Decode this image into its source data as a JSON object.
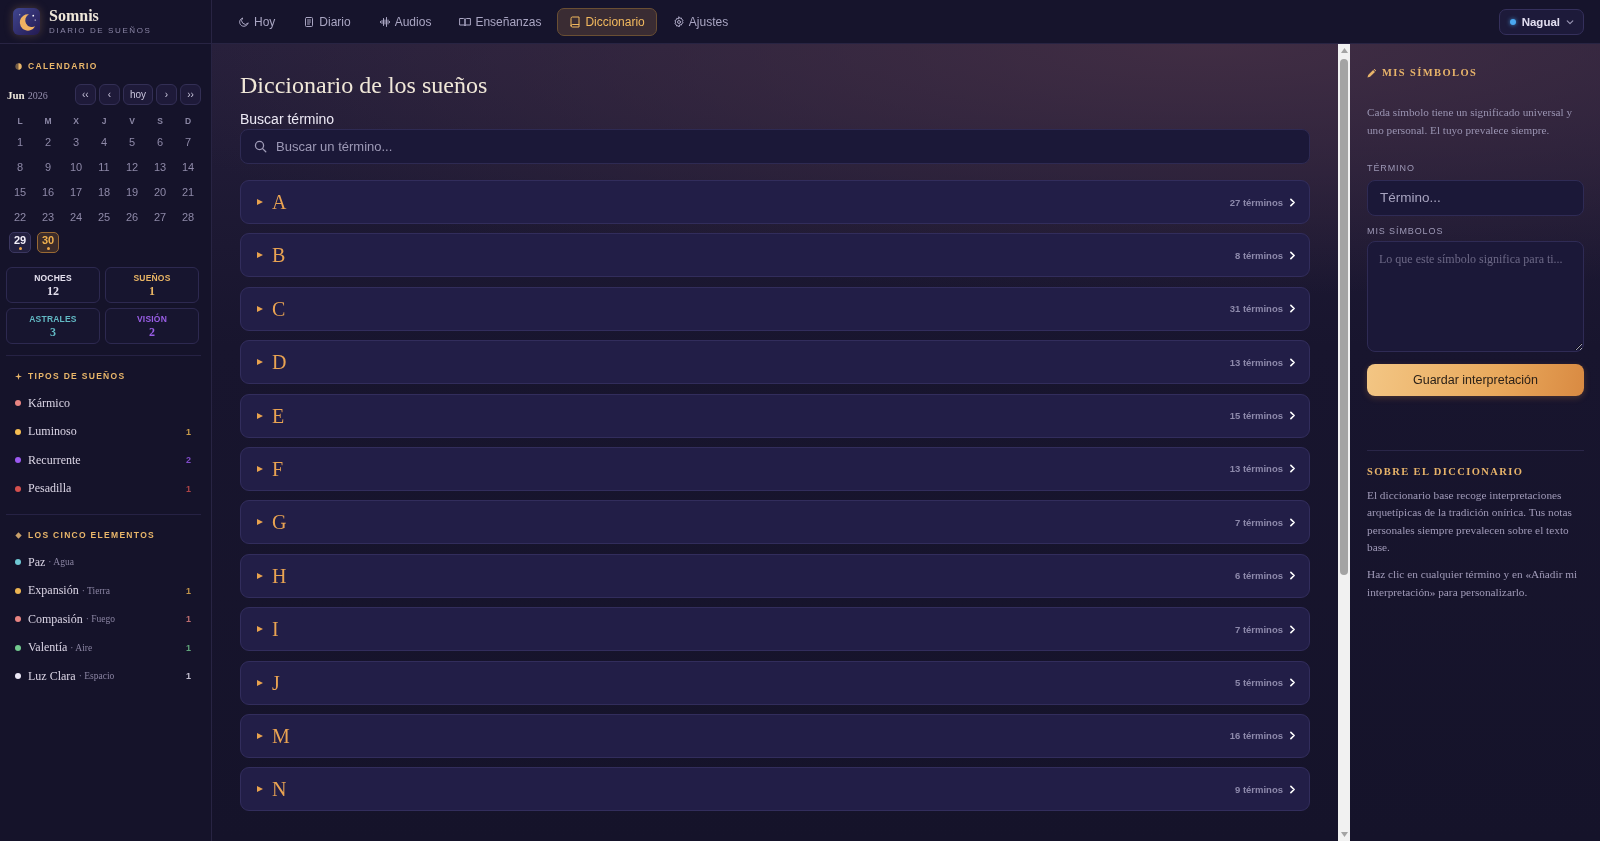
{
  "app": {
    "name": "Somnis",
    "tagline": "DIARIO DE SUEÑOS"
  },
  "nav": {
    "tabs": [
      {
        "label": "Hoy",
        "selected": false
      },
      {
        "label": "Diario",
        "selected": false
      },
      {
        "label": "Audios",
        "selected": false
      },
      {
        "label": "Enseñanzas",
        "selected": false
      },
      {
        "label": "Diccionario",
        "selected": true
      },
      {
        "label": "Ajustes",
        "selected": false
      }
    ],
    "profile": "Nagual"
  },
  "calendar": {
    "title": "CALENDARIO",
    "month": "Jun",
    "year": "2026",
    "buttons": [
      "‹‹",
      "‹",
      "hoy",
      "›",
      "››"
    ],
    "weekdays": [
      "L",
      "M",
      "X",
      "J",
      "V",
      "S",
      "D"
    ],
    "days": [
      {
        "day": "1",
        "has_entry": false,
        "selected": false
      },
      {
        "day": "2",
        "has_entry": false,
        "selected": false
      },
      {
        "day": "3",
        "has_entry": false,
        "selected": false
      },
      {
        "day": "4",
        "has_entry": false,
        "selected": false
      },
      {
        "day": "5",
        "has_entry": false,
        "selected": false
      },
      {
        "day": "6",
        "has_entry": false,
        "selected": false
      },
      {
        "day": "7",
        "has_entry": false,
        "selected": false
      },
      {
        "day": "8",
        "has_entry": false,
        "selected": false
      },
      {
        "day": "9",
        "has_entry": false,
        "selected": false
      },
      {
        "day": "10",
        "has_entry": false,
        "selected": false
      },
      {
        "day": "11",
        "has_entry": false,
        "selected": false
      },
      {
        "day": "12",
        "has_entry": false,
        "selected": false
      },
      {
        "day": "13",
        "has_entry": false,
        "selected": false
      },
      {
        "day": "14",
        "has_entry": false,
        "selected": false
      },
      {
        "day": "15",
        "has_entry": false,
        "selected": false
      },
      {
        "day": "16",
        "has_entry": false,
        "selected": false
      },
      {
        "day": "17",
        "has_entry": false,
        "selected": false
      },
      {
        "day": "18",
        "has_entry": false,
        "selected": false
      },
      {
        "day": "19",
        "has_entry": false,
        "selected": false
      },
      {
        "day": "20",
        "has_entry": false,
        "selected": false
      },
      {
        "day": "21",
        "has_entry": false,
        "selected": false
      },
      {
        "day": "22",
        "has_entry": false,
        "selected": false
      },
      {
        "day": "23",
        "has_entry": false,
        "selected": false
      },
      {
        "day": "24",
        "has_entry": false,
        "selected": false
      },
      {
        "day": "25",
        "has_entry": false,
        "selected": false
      },
      {
        "day": "26",
        "has_entry": false,
        "selected": false
      },
      {
        "day": "27",
        "has_entry": false,
        "selected": false
      },
      {
        "day": "28",
        "has_entry": false,
        "selected": false
      },
      {
        "day": "29",
        "has_entry": true,
        "selected": false
      },
      {
        "day": "30",
        "has_entry": true,
        "selected": true
      }
    ]
  },
  "stats": [
    {
      "label": "NOCHES",
      "value": "12",
      "color": "#e4e0ee"
    },
    {
      "label": "SUEÑOS",
      "value": "1",
      "color": "#e8b464"
    },
    {
      "label": "ASTRALES",
      "value": "3",
      "color": "#62b9c4"
    },
    {
      "label": "VISIÓN",
      "value": "2",
      "color": "#9a5ee6"
    }
  ],
  "dream_types": {
    "title": "TIPOS DE SUEÑOS",
    "items": [
      {
        "name": "Kármico",
        "color": "#e88482"
      },
      {
        "name": "Luminoso",
        "color": "#f5bd52",
        "count": "1"
      },
      {
        "name": "Recurrente",
        "color": "#9b59f0",
        "count": "2"
      },
      {
        "name": "Pesadilla",
        "color": "#d4504e",
        "count": "1"
      }
    ]
  },
  "elements": {
    "title": "LOS CINCO ELEMENTOS",
    "items": [
      {
        "name": "Paz",
        "detail": "· Agua",
        "color": "#6fc8d4"
      },
      {
        "name": "Expansión",
        "detail": "· Tierra",
        "color": "#ecb552",
        "count": "1"
      },
      {
        "name": "Compasión",
        "detail": "· Fuego",
        "color": "#e88482",
        "count": "1"
      },
      {
        "name": "Valentía",
        "detail": "· Aire",
        "color": "#72c98e",
        "count": "1"
      },
      {
        "name": "Luz Clara",
        "detail": "· Espacio",
        "color": "#ece8f6",
        "count": "1"
      }
    ]
  },
  "dictionary": {
    "title": "Diccionario de los sueños",
    "search": {
      "label": "Buscar término",
      "placeholder": "Buscar un término..."
    },
    "letters": [
      {
        "letter": "A",
        "count": "27 términos",
        "expanded": false
      },
      {
        "letter": "B",
        "count": "8 términos",
        "expanded": false
      },
      {
        "letter": "C",
        "count": "31 términos",
        "expanded": false
      },
      {
        "letter": "D",
        "count": "13 términos",
        "expanded": false
      },
      {
        "letter": "E",
        "count": "15 términos",
        "expanded": false
      },
      {
        "letter": "F",
        "count": "13 términos",
        "expanded": false
      },
      {
        "letter": "G",
        "count": "7 términos",
        "expanded": false
      },
      {
        "letter": "H",
        "count": "6 términos",
        "expanded": false
      },
      {
        "letter": "I",
        "count": "7 términos",
        "expanded": false
      },
      {
        "letter": "J",
        "count": "5 términos",
        "expanded": false
      },
      {
        "letter": "M",
        "count": "16 términos",
        "expanded": false
      },
      {
        "letter": "N",
        "count": "9 términos",
        "expanded": false
      }
    ]
  },
  "my_symbols": {
    "title": "MIS SÍMBOLOS",
    "description": "Cada símbolo tiene un significado universal y uno personal. El tuyo prevalece siempre.",
    "term_label": "TÉRMINO",
    "term_placeholder": "Término...",
    "symbols_label": "MIS SÍMBOLOS",
    "symbols_placeholder": "Lo que este símbolo significa para ti...",
    "save_button": "Guardar interpretación"
  },
  "about": {
    "title": "SOBRE EL DICCIONARIO",
    "paragraphs": [
      "El diccionario base recoge interpretaciones arquetípicas de la tradición onírica. Tus notas personales siempre prevalecen sobre el texto base.",
      "Haz clic en cualquier término y en «Añadir mi interpretación» para personalizarlo."
    ]
  }
}
